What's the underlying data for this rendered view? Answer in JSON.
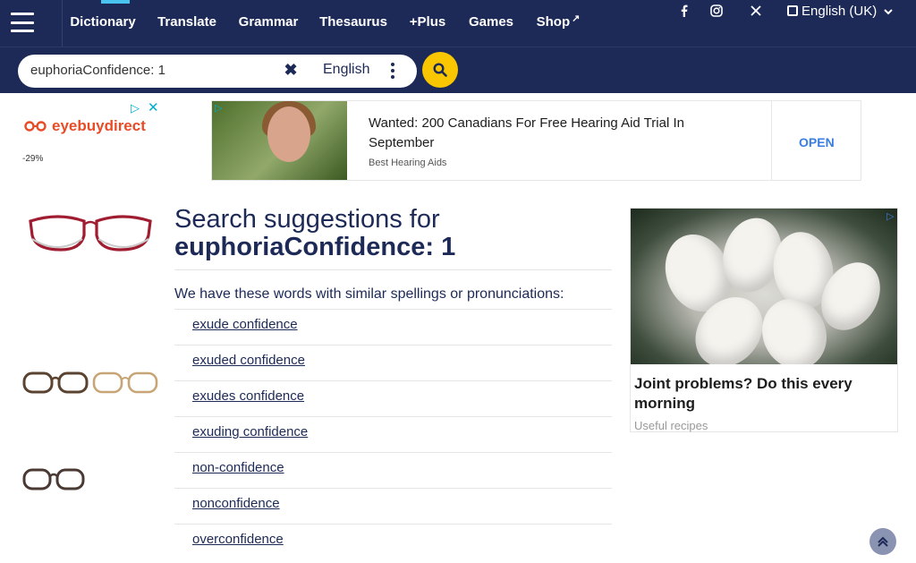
{
  "header": {
    "nav_tabs": [
      {
        "label": "Dictionary"
      },
      {
        "label": "Translate"
      },
      {
        "label": "Grammar"
      },
      {
        "label": "Thesaurus"
      },
      {
        "label": "+Plus"
      },
      {
        "label": "Games"
      },
      {
        "label": "Shop"
      }
    ],
    "site_language": "English (UK)"
  },
  "search": {
    "value": "euphoriaConfidence: 1",
    "language": "English"
  },
  "ads": {
    "left": {
      "brand": "eyebuydirect",
      "discount": "-29%"
    },
    "banner": {
      "headline": "Wanted: 200 Canadians For Free Hearing Aid Trial In September",
      "sponsor": "Best Hearing Aids",
      "cta": "OPEN"
    },
    "right": {
      "headline": "Joint problems? Do this every morning",
      "sponsor": "Useful recipes"
    }
  },
  "results": {
    "heading": "Search suggestions for",
    "query": "euphoriaConfidence: 1",
    "note": "We have these words with similar spellings or pronunciations:",
    "suggestions": [
      "exude confidence",
      "exuded confidence",
      "exudes confidence",
      "exuding confidence",
      "non-confidence",
      "nonconfidence",
      "overconfidence"
    ]
  },
  "colors": {
    "navy": "#1d2a57",
    "accent_yellow": "#f9c600",
    "active_tab": "#49c3f0"
  }
}
